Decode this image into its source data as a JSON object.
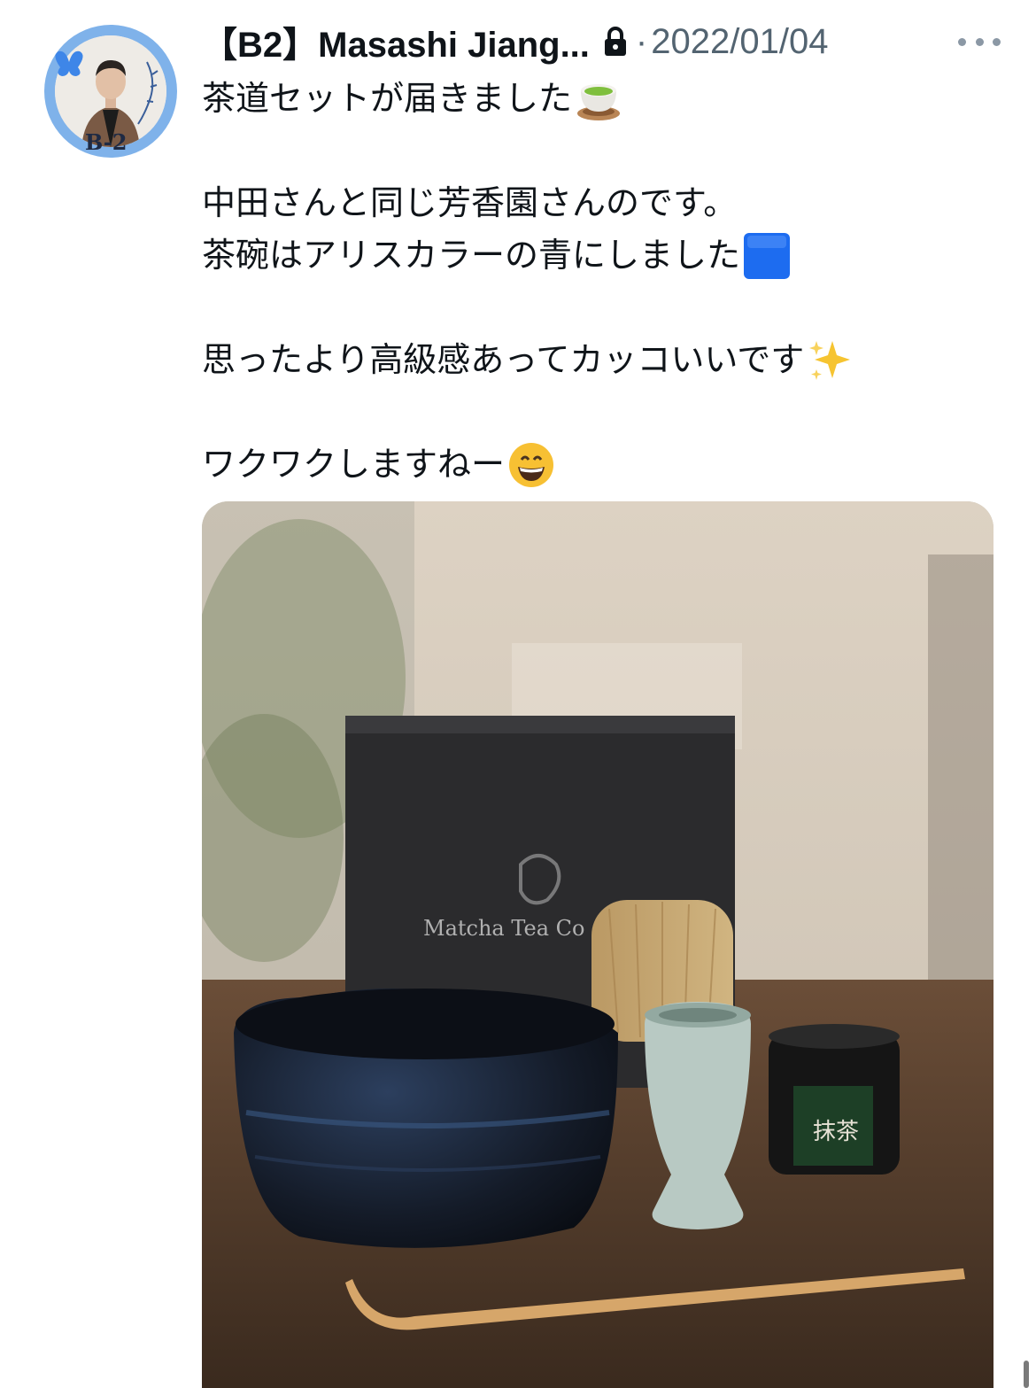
{
  "tweet": {
    "author_name": "【B2】Masashi Jiang...",
    "separator": "·",
    "date": "2022/01/04",
    "lines": [
      "茶道セットが届きました",
      "",
      "中田さんと同じ芳香園さんのです。",
      "茶碗はアリスカラーの青にしました",
      "",
      "思ったより高級感あってカッコいいです",
      "",
      "ワクワクしますねー"
    ],
    "emojis": {
      "line1": "teacup-emoji",
      "line4": "blue-square-emoji",
      "line6": "sparkles-emoji",
      "line8": "grinning-face-emoji"
    }
  },
  "avatar": {
    "badge_text": "B-2"
  },
  "photo": {
    "box_label": "Matcha Tea Co",
    "tin_label": "抹茶"
  },
  "colors": {
    "text": "#0f1419",
    "secondary": "#536471",
    "avatar_ring": "#7fb2ea",
    "blue_square": "#1d6cf0"
  }
}
